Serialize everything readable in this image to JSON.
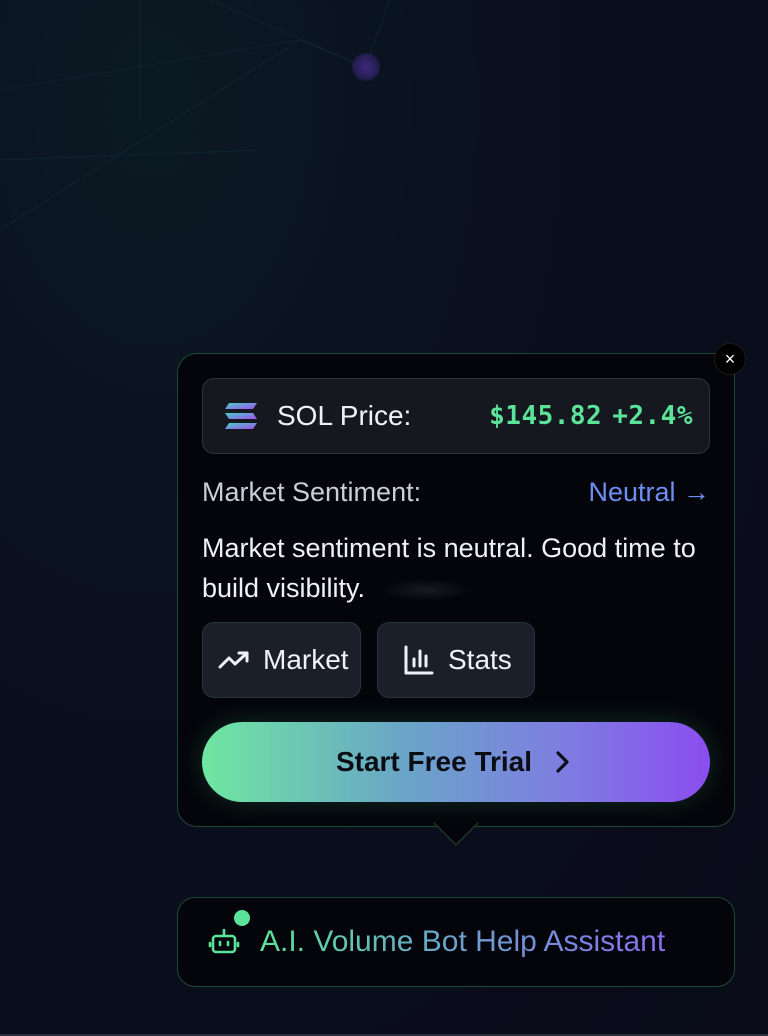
{
  "theme": {
    "accent_green": "#5be39a",
    "accent_blue": "#6e8ef5",
    "accent_purple": "#8b4df0",
    "background": "#0a0d1c"
  },
  "popup": {
    "close_icon": "close-icon",
    "close_label": "×",
    "price": {
      "icon": "solana-logo-icon",
      "label": "SOL Price:",
      "value": "$145.82",
      "change": "+2.4%"
    },
    "sentiment": {
      "label": "Market Sentiment:",
      "value": "Neutral →"
    },
    "description": "Market sentiment is neutral. Good time to build visibility.",
    "chips": [
      {
        "label": "Market",
        "icon": "trending-up-icon"
      },
      {
        "label": "Stats",
        "icon": "bar-chart-icon"
      }
    ],
    "cta": {
      "label": "Start Free Trial",
      "icon": "chevron-right-icon"
    }
  },
  "assistant": {
    "icon": "robot-icon",
    "status": "online",
    "label": "A.I. Volume Bot Help Assistant"
  }
}
